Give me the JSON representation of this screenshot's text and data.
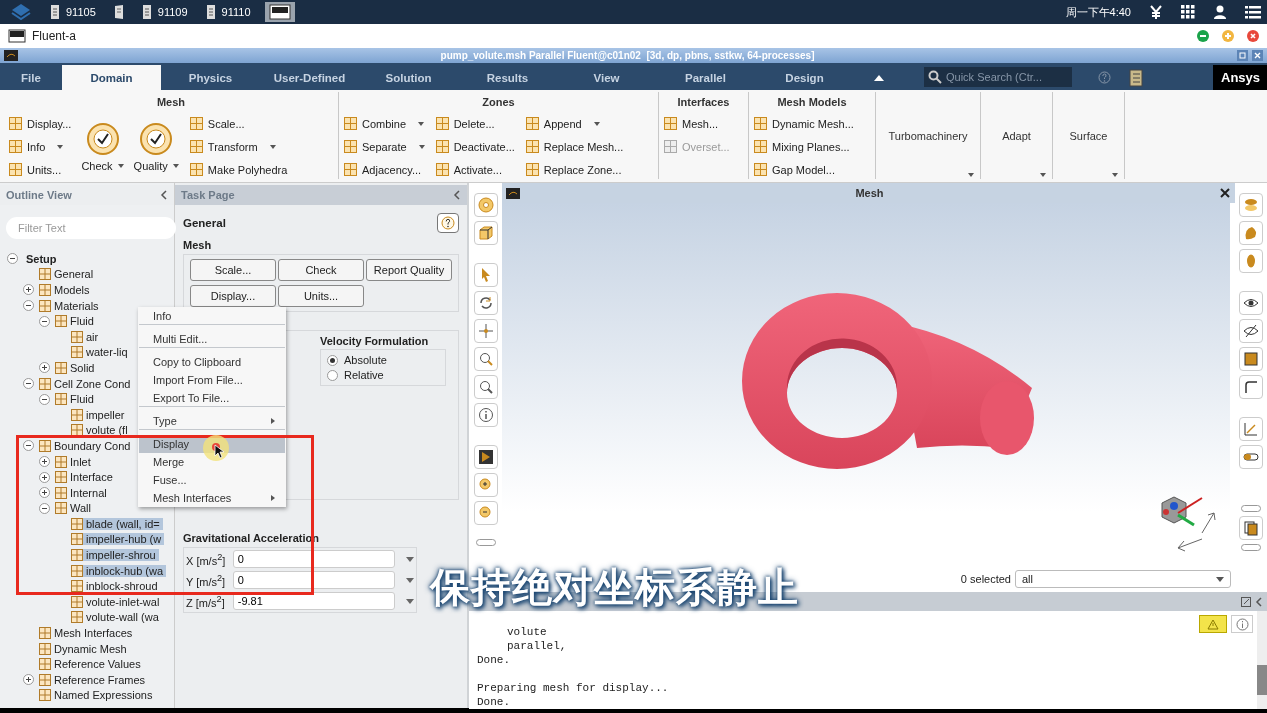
{
  "taskbar": {
    "items": [
      {
        "kind": "labeled",
        "label": "91105",
        "selected": false
      },
      {
        "kind": "icon",
        "selected": false
      },
      {
        "kind": "labeled",
        "label": "91109",
        "selected": false
      },
      {
        "kind": "labeled",
        "label": "91110",
        "selected": false
      },
      {
        "kind": "icon",
        "selected": true
      }
    ],
    "clock": "周一下午4:40"
  },
  "window": {
    "title": "Fluent-a"
  },
  "fluent": {
    "title": "pump_volute.msh Parallel Fluent@c01n02  [3d, dp, pbns, sstkw, 64-processes]"
  },
  "ribbon_tabs": [
    {
      "label": "File",
      "selected": false
    },
    {
      "label": "Domain",
      "selected": true
    },
    {
      "label": "Physics",
      "selected": false
    },
    {
      "label": "User-Defined",
      "selected": false
    },
    {
      "label": "Solution",
      "selected": false
    },
    {
      "label": "Results",
      "selected": false
    },
    {
      "label": "View",
      "selected": false
    },
    {
      "label": "Parallel",
      "selected": false
    },
    {
      "label": "Design",
      "selected": false
    }
  ],
  "search": {
    "placeholder": "Quick Search (Ctr..."
  },
  "brand": "Ansys",
  "ribbon": {
    "groups": [
      {
        "title": "Mesh",
        "columns": [
          [
            {
              "kind": "small",
              "label": "Display...",
              "dropdown": false,
              "disabled": false
            },
            {
              "kind": "small",
              "label": "Info",
              "dropdown": true,
              "disabled": false
            },
            {
              "kind": "small",
              "label": "Units...",
              "dropdown": false,
              "disabled": false
            }
          ],
          [
            {
              "kind": "large",
              "label": "Check",
              "dropdown": true,
              "disabled": false
            }
          ],
          [
            {
              "kind": "large",
              "label": "Quality",
              "dropdown": true,
              "disabled": false
            }
          ],
          [
            {
              "kind": "small",
              "label": "Scale...",
              "dropdown": false,
              "disabled": false
            },
            {
              "kind": "small",
              "label": "Transform",
              "dropdown": true,
              "disabled": false
            },
            {
              "kind": "small",
              "label": "Make Polyhedra",
              "dropdown": false,
              "disabled": false
            }
          ]
        ]
      },
      {
        "title": "Zones",
        "columns": [
          [
            {
              "kind": "small",
              "label": "Combine",
              "dropdown": true,
              "disabled": false
            },
            {
              "kind": "small",
              "label": "Separate",
              "dropdown": true,
              "disabled": false
            },
            {
              "kind": "small",
              "label": "Adjacency...",
              "dropdown": false,
              "disabled": false
            }
          ],
          [
            {
              "kind": "small",
              "label": "Delete...",
              "dropdown": false,
              "disabled": false
            },
            {
              "kind": "small",
              "label": "Deactivate...",
              "dropdown": false,
              "disabled": false
            },
            {
              "kind": "small",
              "label": "Activate...",
              "dropdown": false,
              "disabled": false
            }
          ],
          [
            {
              "kind": "small",
              "label": "Append",
              "dropdown": true,
              "disabled": false
            },
            {
              "kind": "small",
              "label": "Replace Mesh...",
              "dropdown": false,
              "disabled": false
            },
            {
              "kind": "small",
              "label": "Replace Zone...",
              "dropdown": false,
              "disabled": false
            }
          ]
        ]
      },
      {
        "title": "Interfaces",
        "columns": [
          [
            {
              "kind": "small",
              "label": "Mesh...",
              "dropdown": false,
              "disabled": false
            },
            {
              "kind": "small",
              "label": "Overset...",
              "dropdown": false,
              "disabled": true
            }
          ]
        ]
      },
      {
        "title": "Mesh Models",
        "columns": [
          [
            {
              "kind": "small",
              "label": "Dynamic Mesh...",
              "dropdown": false,
              "disabled": false
            },
            {
              "kind": "small",
              "label": "Mixing Planes...",
              "dropdown": false,
              "disabled": false
            },
            {
              "kind": "small",
              "label": "Gap Model...",
              "dropdown": false,
              "disabled": false
            }
          ]
        ]
      },
      {
        "title": "Turbomachinery",
        "kind": "collapsed"
      },
      {
        "title": "Adapt",
        "kind": "collapsed"
      },
      {
        "title": "Surface",
        "kind": "collapsed"
      }
    ]
  },
  "outline": {
    "title": "Outline View",
    "filter_placeholder": "Filter Text",
    "tree": [
      {
        "label": "Setup",
        "expanded": true,
        "selected": false,
        "children": [
          {
            "label": "General",
            "selected": false
          },
          {
            "label": "Models",
            "expanded": false,
            "selected": false
          },
          {
            "label": "Materials",
            "expanded": true,
            "selected": false,
            "children": [
              {
                "label": "Fluid",
                "expanded": true,
                "selected": false,
                "children": [
                  {
                    "label": "air",
                    "selected": false
                  },
                  {
                    "label": "water-liq",
                    "selected": false
                  }
                ]
              },
              {
                "label": "Solid",
                "expanded": false,
                "selected": false
              }
            ]
          },
          {
            "label": "Cell Zone Cond",
            "expanded": true,
            "selected": false,
            "children": [
              {
                "label": "Fluid",
                "expanded": true,
                "selected": false,
                "children": [
                  {
                    "label": "impeller",
                    "selected": false
                  },
                  {
                    "label": "volute (fl",
                    "selected": false
                  }
                ]
              }
            ]
          },
          {
            "label": "Boundary Cond",
            "expanded": true,
            "selected": false,
            "children": [
              {
                "label": "Inlet",
                "expanded": false,
                "selected": false
              },
              {
                "label": "Interface",
                "expanded": false,
                "selected": false
              },
              {
                "label": "Internal",
                "expanded": false,
                "selected": false
              },
              {
                "label": "Wall",
                "expanded": true,
                "selected": false,
                "children": [
                  {
                    "label": "blade (wall, id=",
                    "selected": true
                  },
                  {
                    "label": "impeller-hub (w",
                    "selected": true
                  },
                  {
                    "label": "impeller-shrou",
                    "selected": true
                  },
                  {
                    "label": "inblock-hub (wa",
                    "selected": true
                  },
                  {
                    "label": "inblock-shroud",
                    "selected": false
                  },
                  {
                    "label": "volute-inlet-wal",
                    "selected": false
                  },
                  {
                    "label": "volute-wall (wa",
                    "selected": false
                  }
                ]
              }
            ]
          },
          {
            "label": "Mesh Interfaces",
            "selected": false
          },
          {
            "label": "Dynamic Mesh",
            "selected": false
          },
          {
            "label": "Reference Values",
            "selected": false
          },
          {
            "label": "Reference Frames",
            "expanded": false,
            "selected": false
          },
          {
            "label": "Named Expressions",
            "selected": false
          }
        ]
      }
    ]
  },
  "task_page": {
    "title": "Task Page",
    "heading": "General",
    "mesh": {
      "title": "Mesh",
      "buttons": [
        "Scale...",
        "Check",
        "Report Quality",
        "Display...",
        "Units..."
      ]
    },
    "velocity": {
      "title": "Velocity Formulation",
      "options": [
        {
          "label": "Absolute",
          "selected": true
        },
        {
          "label": "Relative",
          "selected": false
        }
      ]
    },
    "gravity": {
      "title": "Gravitational Acceleration",
      "fields": [
        {
          "label": "X [m/s$^{2}$]",
          "value": "0"
        },
        {
          "label": "Y [m/s$^{2}$]",
          "value": "0"
        },
        {
          "label": "Z [m/s$^{2}$]",
          "value": "-9.81"
        }
      ]
    }
  },
  "context_menu": {
    "items": [
      {
        "label": "Info",
        "submenu": false,
        "selected": false,
        "separator_after": true
      },
      {
        "label": "Multi Edit...",
        "submenu": false,
        "selected": false,
        "separator_after": true
      },
      {
        "label": "Copy to Clipboard",
        "submenu": false,
        "selected": false,
        "separator_after": false
      },
      {
        "label": "Import From File...",
        "submenu": false,
        "selected": false,
        "separator_after": false
      },
      {
        "label": "Export To File...",
        "submenu": false,
        "selected": false,
        "separator_after": true
      },
      {
        "label": "Type",
        "submenu": true,
        "selected": false,
        "separator_after": true
      },
      {
        "label": "Display",
        "submenu": false,
        "selected": true,
        "separator_after": false
      },
      {
        "label": "Merge",
        "submenu": false,
        "selected": false,
        "separator_after": false
      },
      {
        "label": "Fuse...",
        "submenu": false,
        "selected": false,
        "separator_after": false
      },
      {
        "label": "Mesh Interfaces",
        "submenu": true,
        "selected": false,
        "separator_after": false
      }
    ]
  },
  "graphics": {
    "title": "Mesh",
    "selection_count": "0 selected",
    "filter": "all"
  },
  "console": {
    "lines": [
      {
        "text": "volute",
        "kind": "indented"
      },
      {
        "text": "parallel,",
        "kind": "indented"
      },
      {
        "text": "Done.",
        "kind": "plain"
      },
      {
        "text": "Preparing mesh for display...",
        "kind": "spaced"
      },
      {
        "text": "Done.",
        "kind": "plain"
      }
    ]
  },
  "subtitle": "保持绝对坐标系静止"
}
